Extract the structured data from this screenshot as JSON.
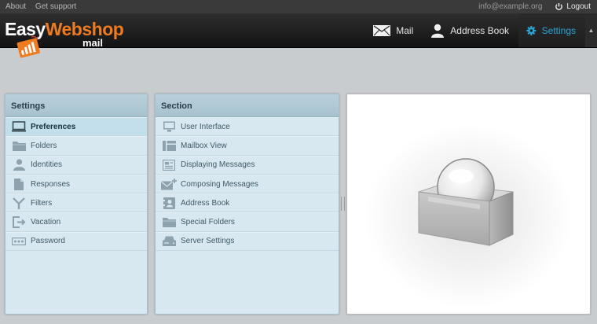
{
  "topbar": {
    "about": "About",
    "support": "Get support",
    "email": "info@example.org",
    "logout": "Logout"
  },
  "logo": {
    "easy": "Easy",
    "webshop": "Webshop",
    "mail": "mail"
  },
  "nav": {
    "mail": "Mail",
    "addressbook": "Address Book",
    "settings": "Settings"
  },
  "settings": {
    "title": "Settings",
    "items": [
      {
        "label": "Preferences",
        "icon": "monitor-icon"
      },
      {
        "label": "Folders",
        "icon": "folder-icon"
      },
      {
        "label": "Identities",
        "icon": "person-icon"
      },
      {
        "label": "Responses",
        "icon": "document-icon"
      },
      {
        "label": "Filters",
        "icon": "filter-icon"
      },
      {
        "label": "Vacation",
        "icon": "exit-icon"
      },
      {
        "label": "Password",
        "icon": "password-icon"
      }
    ]
  },
  "section": {
    "title": "Section",
    "items": [
      {
        "label": "User Interface",
        "icon": "monitor-icon"
      },
      {
        "label": "Mailbox View",
        "icon": "mailbox-view-icon"
      },
      {
        "label": "Displaying Messages",
        "icon": "message-icon"
      },
      {
        "label": "Composing Messages",
        "icon": "compose-icon"
      },
      {
        "label": "Address Book",
        "icon": "addressbook-icon"
      },
      {
        "label": "Special Folders",
        "icon": "folder-icon"
      },
      {
        "label": "Server Settings",
        "icon": "server-icon"
      }
    ]
  },
  "colors": {
    "accent": "#2aa6d6",
    "brand_orange": "#f07a1e",
    "panel_bg": "#d7e8f0",
    "selected_bg": "#c4dfec"
  }
}
